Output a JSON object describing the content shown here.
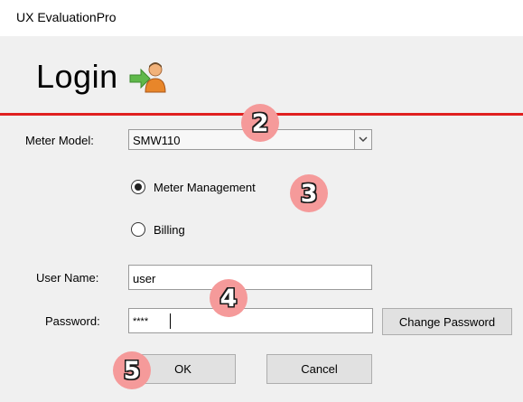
{
  "app": {
    "title": "UX EvaluationPro"
  },
  "header": {
    "title": "Login",
    "icon": "login-user-arrow-icon"
  },
  "form": {
    "meter_model_label": "Meter Model:",
    "meter_model_value": "SMW110",
    "mode_options": [
      {
        "label": "Meter Management",
        "selected": true
      },
      {
        "label": "Billing",
        "selected": false
      }
    ],
    "username_label": "User Name:",
    "username_value": "user",
    "password_label": "Password:",
    "password_value": "****",
    "change_password_label": "Change Password",
    "ok_label": "OK",
    "cancel_label": "Cancel"
  },
  "annotations": [
    {
      "number": "2"
    },
    {
      "number": "3"
    },
    {
      "number": "4"
    },
    {
      "number": "5"
    }
  ],
  "colors": {
    "divider": "#e02020",
    "badge": "#f59a9a"
  }
}
